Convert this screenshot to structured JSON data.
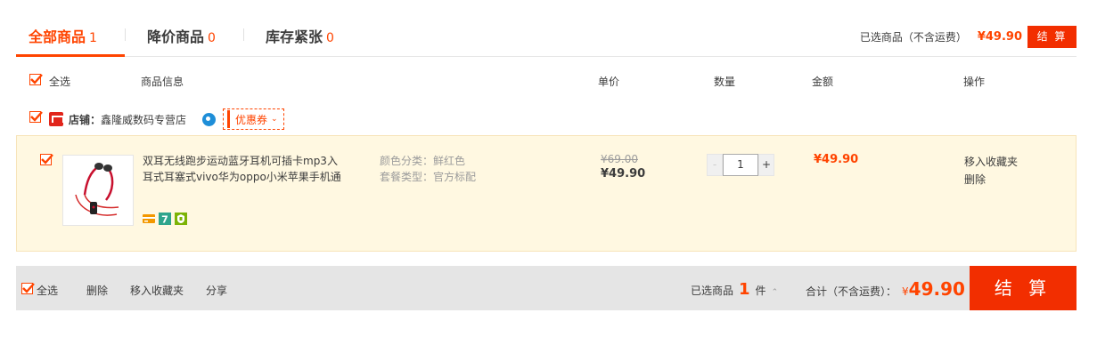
{
  "tabs": [
    {
      "label": "全部商品",
      "count": "1"
    },
    {
      "label": "降价商品",
      "count": "0"
    },
    {
      "label": "库存紧张",
      "count": "0"
    }
  ],
  "top_summary": {
    "label": "已选商品（不含运费）",
    "amount": "¥49.90",
    "checkout": "结 算"
  },
  "columns": {
    "select_all": "全选",
    "info": "商品信息",
    "unit_price": "单价",
    "quantity": "数量",
    "amount": "金额",
    "actions": "操作"
  },
  "shop": {
    "prefix": "店铺：",
    "name": "鑫隆威数码专营店",
    "coupon": "优惠券"
  },
  "item": {
    "title_line1": "双耳无线跑步运动蓝牙耳机可插卡mp3入",
    "title_line2": "耳式耳塞式vivo华为oppo小米苹果手机通",
    "prop1": "颜色分类：鲜红色",
    "prop2": "套餐类型：官方标配",
    "original_price": "¥69.00",
    "price": "¥49.90",
    "qty_minus": "-",
    "qty_value": "1",
    "qty_plus": "+",
    "subtotal": "¥49.90",
    "action_fav": "移入收藏夹",
    "action_delete": "删除"
  },
  "footer": {
    "select_all": "全选",
    "delete": "删除",
    "move_fav": "移入收藏夹",
    "share": "分享",
    "selected_prefix": "已选商品",
    "selected_count": "1",
    "selected_suffix": "件",
    "total_label": "合计（不含运费）：",
    "currency": "¥",
    "total_amount": "49.90",
    "checkout": "结 算"
  },
  "colors": {
    "accent": "#ff4400",
    "button": "#f22e00",
    "item_bg": "#fff8e1",
    "footer_bg": "#e5e5e5"
  }
}
